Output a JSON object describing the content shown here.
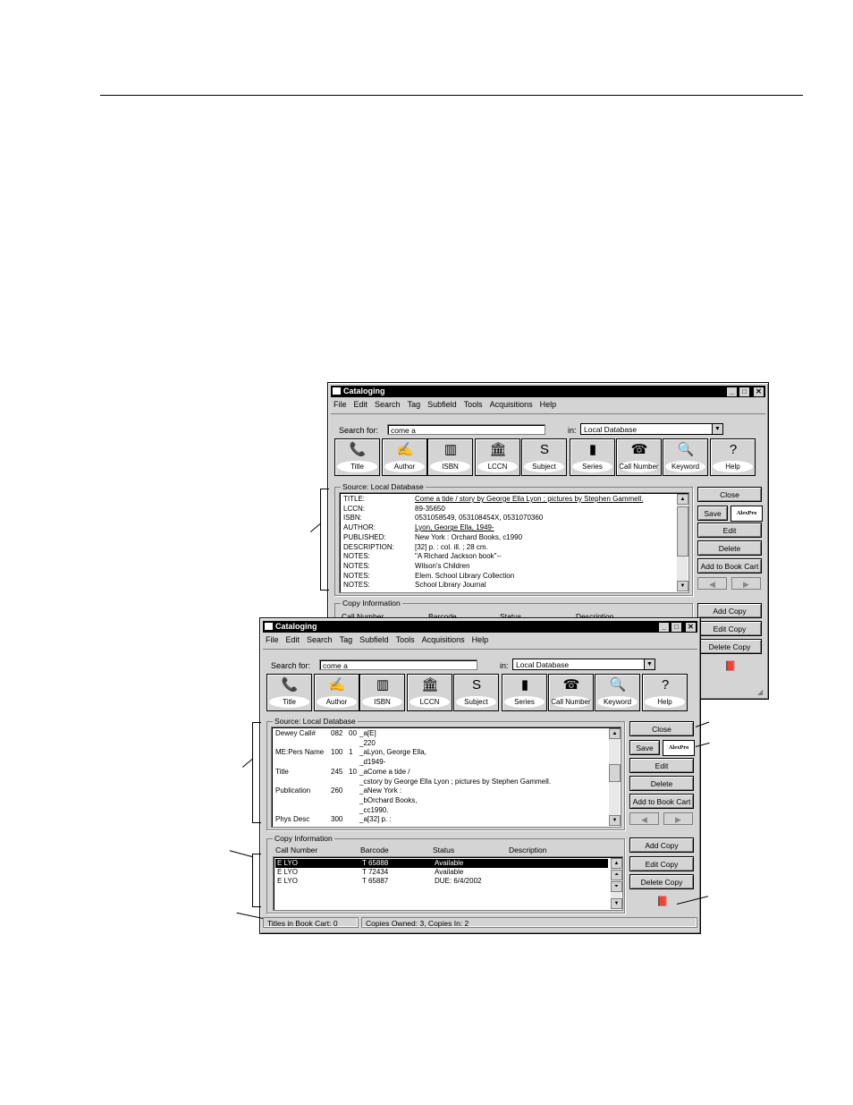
{
  "menu_items": [
    "File",
    "Edit",
    "Search",
    "Tag",
    "Subfield",
    "Tools",
    "Acquisitions",
    "Help"
  ],
  "toolbar": [
    {
      "label": "Title",
      "icon": "title-icon",
      "glyph": "📞"
    },
    {
      "label": "Author",
      "icon": "author-icon",
      "glyph": "✍"
    },
    {
      "label": "ISBN",
      "icon": "isbn-icon",
      "glyph": "▥"
    },
    {
      "label": "LCCN",
      "icon": "lccn-icon",
      "glyph": "🏛"
    },
    {
      "label": "Subject",
      "icon": "subject-icon",
      "glyph": "S"
    },
    {
      "label": "Series",
      "icon": "series-icon",
      "glyph": "▮"
    },
    {
      "label": "Call Number",
      "icon": "call-number-icon",
      "glyph": "☎"
    },
    {
      "label": "Keyword",
      "icon": "keyword-icon",
      "glyph": "🔍"
    },
    {
      "label": "Help",
      "icon": "help-icon",
      "glyph": "?"
    }
  ],
  "back_window": {
    "title": "Cataloging",
    "search_label": "Search for:",
    "search_value": "come a",
    "in_label": "in:",
    "database": "Local Database",
    "source_label": "Source:  Local Database",
    "record": [
      {
        "key": "TITLE:",
        "value": "Come a tide / story by George Ella Lyon ; pictures by Stephen Gammell."
      },
      {
        "key": "LCCN:",
        "value": "89-35650"
      },
      {
        "key": "ISBN:",
        "value": "0531058549, 053108454X, 0531070360"
      },
      {
        "key": "AUTHOR:",
        "value": "Lyon, George Ella, 1949-"
      },
      {
        "key": "PUBLISHED:",
        "value": "New York : Orchard Books, c1990"
      },
      {
        "key": "DESCRIPTION:",
        "value": "[32] p. : col. ill. ; 28 cm."
      },
      {
        "key": "NOTES:",
        "value": "\"A Richard Jackson book\"--"
      },
      {
        "key": "NOTES:",
        "value": "Wilson's Children"
      },
      {
        "key": "NOTES:",
        "value": "Elem. School Library Collection"
      },
      {
        "key": "NOTES:",
        "value": "School Library Journal"
      }
    ],
    "copy_info_label": "Copy Information",
    "copy_headers": {
      "call_number": "Call Number",
      "barcode": "Barcode",
      "status": "Status",
      "description": "Description"
    },
    "buttons": {
      "close": "Close",
      "save": "Save",
      "edit": "Edit",
      "delete": "Delete",
      "add_to_cart": "Add to Book Cart",
      "add_copy": "Add Copy",
      "edit_copy": "Edit Copy",
      "delete_copy": "Delete Copy"
    }
  },
  "front_window": {
    "title": "Cataloging",
    "search_label": "Search for:",
    "search_value": "come a",
    "in_label": "in:",
    "database": "Local Database",
    "source_label": "Source:  Local Database",
    "marc": [
      {
        "name": "Dewey Call#",
        "tag": "082",
        "ind": "00",
        "value": "_a[E]"
      },
      {
        "name": "",
        "tag": "",
        "ind": "",
        "value": "_220"
      },
      {
        "name": "ME:Pers Name",
        "tag": "100",
        "ind": "1",
        "value": "_aLyon, George Ella,"
      },
      {
        "name": "",
        "tag": "",
        "ind": "",
        "value": "_d1949-"
      },
      {
        "name": "Title",
        "tag": "245",
        "ind": "10",
        "value": "_aCome a tide /"
      },
      {
        "name": "",
        "tag": "",
        "ind": "",
        "value": "_cstory by George Ella Lyon ; pictures by Stephen Gammell."
      },
      {
        "name": "Publication",
        "tag": "260",
        "ind": "",
        "value": "_aNew York :"
      },
      {
        "name": "",
        "tag": "",
        "ind": "",
        "value": "_bOrchard Books,"
      },
      {
        "name": "",
        "tag": "",
        "ind": "",
        "value": "_cc1990."
      },
      {
        "name": "Phys Desc",
        "tag": "300",
        "ind": "",
        "value": "_a[32] p. :"
      }
    ],
    "copy_info_label": "Copy Information",
    "copy_headers": {
      "call_number": "Call Number",
      "barcode": "Barcode",
      "status": "Status",
      "description": "Description"
    },
    "copies": [
      {
        "call_number": "E LYO",
        "barcode": "T 65888",
        "status": "Available",
        "description": ""
      },
      {
        "call_number": "E LYO",
        "barcode": "T 72434",
        "status": "Available",
        "description": ""
      },
      {
        "call_number": "E LYO",
        "barcode": "T 65887",
        "status": "DUE: 6/4/2002",
        "description": ""
      }
    ],
    "buttons": {
      "close": "Close",
      "save": "Save",
      "edit": "Edit",
      "delete": "Delete",
      "add_to_cart": "Add to Book Cart",
      "add_copy": "Add Copy",
      "edit_copy": "Edit Copy",
      "delete_copy": "Delete Copy"
    },
    "status": {
      "cart": "Titles in Book Cart:  0",
      "copies": "Copies Owned:  3, Copies In:  2"
    }
  },
  "logo_text": "AlexPro",
  "colors": {
    "window_face": "#d4d4d4",
    "titlebar": "#000000",
    "selection": "#000000"
  }
}
